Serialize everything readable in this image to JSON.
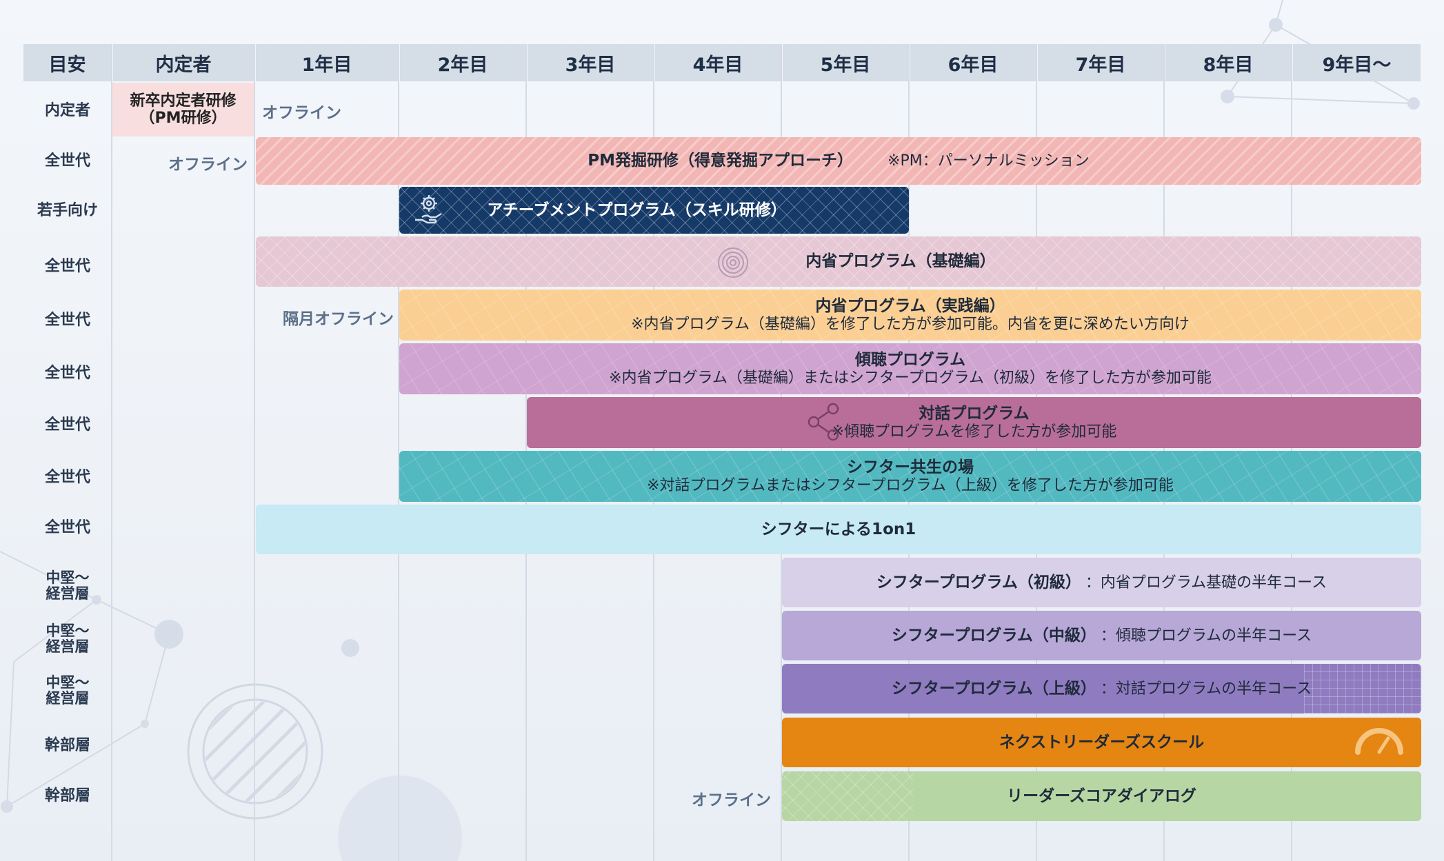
{
  "columns": [
    "目安",
    "内定者",
    "1年目",
    "2年目",
    "3年目",
    "4年目",
    "5年目",
    "6年目",
    "7年目",
    "8年目",
    "9年目〜"
  ],
  "row_labels": [
    "内定者",
    "全世代",
    "若手向け",
    "全世代",
    "全世代",
    "全世代",
    "全世代",
    "全世代",
    "全世代",
    "中堅〜\n経営層",
    "中堅〜\n経営層",
    "中堅〜\n経営層",
    "幹部層",
    "幹部層"
  ],
  "naitei_cell": {
    "title": "新卒内定者研修\n（PM研修）"
  },
  "notes": {
    "row1_offline": "オフライン",
    "row2_offline": "オフライン",
    "row5_offline": "隔月オフライン",
    "row14_offline": "オフライン"
  },
  "bars": {
    "pm": {
      "title": "PM発掘研修（得意発掘アプローチ）",
      "sub": "※PM：パーソナルミッション",
      "color": "#f2b6b4"
    },
    "achievement": {
      "title": "アチーブメントプログラム（スキル研修）",
      "color": "#163a68"
    },
    "naisei_basic": {
      "title": "内省プログラム（基礎編）",
      "color": "#e6c8d4"
    },
    "naisei_practice": {
      "title": "内省プログラム（実践編）",
      "sub": "※内省プログラム（基礎編）を修了した方が参加可能。内省を更に深めたい方向け",
      "color": "#fbcf94"
    },
    "keicho": {
      "title": "傾聴プログラム",
      "sub": "※内省プログラム（基礎編）またはシフタープログラム（初級）を修了した方が参加可能",
      "color": "#cfa4d0"
    },
    "taiwa": {
      "title": "対話プログラム",
      "sub": "※傾聴プログラムを修了した方が参加可能",
      "color": "#b86e98"
    },
    "kyosei": {
      "title": "シフター共生の場",
      "sub": "※対話プログラムまたはシフタープログラム（上級）を修了した方が参加可能",
      "color": "#53b9c0"
    },
    "oneonone": {
      "title": "シフターによる1on1",
      "color": "#c7eaf4"
    },
    "shifter_beginner": {
      "title": "シフタープログラム（初級）",
      "sub": "：内省プログラム基礎の半年コース",
      "color": "#d7d0e8"
    },
    "shifter_middle": {
      "title": "シフタープログラム（中級）",
      "sub": "：傾聴プログラムの半年コース",
      "color": "#b7a8d8"
    },
    "shifter_advanced": {
      "title": "シフタープログラム（上級）",
      "sub": "：対話プログラムの半年コース",
      "color": "#8f7cc0"
    },
    "next_leaders": {
      "title": "ネクストリーダーズスクール",
      "color": "#e58512"
    },
    "leaders_core": {
      "title": "リーダーズコアダイアログ",
      "color": "#b6d6a4"
    }
  },
  "icons": {
    "achievement": "hand-gear-icon",
    "naisei_basic": "concentric-circles-icon",
    "taiwa": "share-icon",
    "next_leaders": "gauge-icon"
  }
}
